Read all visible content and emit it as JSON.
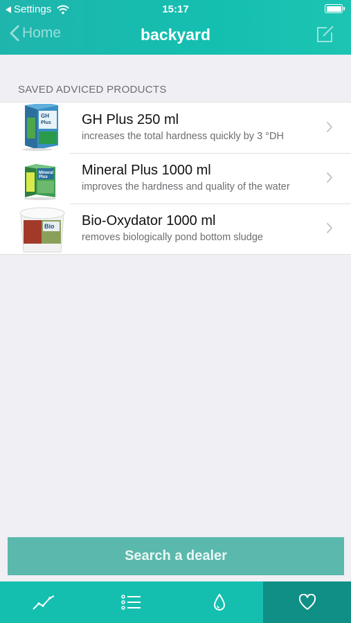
{
  "status_bar": {
    "back_app_label": "Settings",
    "time": "15:17"
  },
  "nav": {
    "back_label": "Home",
    "title": "backyard"
  },
  "section": {
    "title": "SAVED ADVICED PRODUCTS"
  },
  "products": [
    {
      "title": "GH Plus 250 ml",
      "subtitle": "increases the total hardness quickly by 3 °DH",
      "image": "gh-plus-box",
      "box_label": "GH Plus"
    },
    {
      "title": "Mineral Plus 1000 ml",
      "subtitle": "improves the hardness and quality of the water",
      "image": "mineral-plus-box",
      "box_label": "Mineral Plus"
    },
    {
      "title": "Bio-Oxydator 1000 ml",
      "subtitle": "removes biologically pond bottom sludge",
      "image": "bio-oxydator-bucket",
      "box_label": "Bio"
    }
  ],
  "cta": {
    "label": "Search a dealer"
  },
  "tabs": [
    {
      "icon": "chart-line-icon",
      "active": false
    },
    {
      "icon": "list-icon",
      "active": false
    },
    {
      "icon": "water-drop-icon",
      "active": false
    },
    {
      "icon": "heart-icon",
      "active": true
    }
  ],
  "colors": {
    "header": "#1fb5ad",
    "tabbar": "#14bfb0",
    "tab_active": "#0f8f85",
    "cta_button": "#5bb8ac",
    "background": "#efeff4"
  }
}
